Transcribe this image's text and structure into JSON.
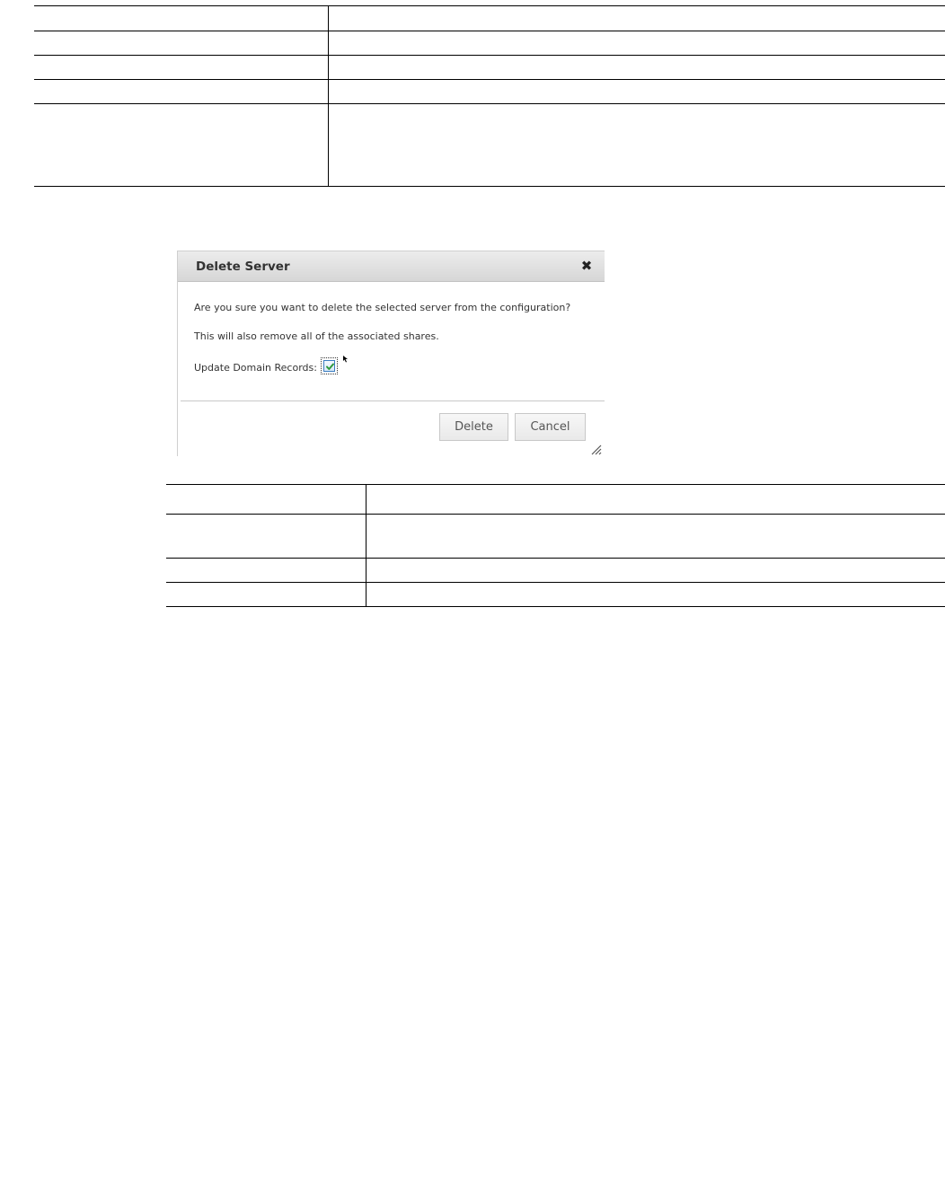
{
  "top_table": {
    "rows": [
      {
        "label": "",
        "value": ""
      },
      {
        "label": "",
        "value": ""
      },
      {
        "label": "",
        "value": ""
      },
      {
        "label": "",
        "value": ""
      },
      {
        "label": "",
        "value": ""
      }
    ]
  },
  "dialog": {
    "title": "Delete Server",
    "close_icon": "close-icon",
    "message_1": "Are you sure you want to delete the selected server from the configuration?",
    "message_2": "This will also remove all of the associated shares.",
    "update_label": "Update Domain Records:",
    "update_checked": true,
    "delete_label": "Delete",
    "cancel_label": "Cancel",
    "accent_color": "#3a7cc0",
    "check_color": "#2e9a3c"
  },
  "bottom_table": {
    "rows": [
      {
        "label": "",
        "value": ""
      },
      {
        "label": "",
        "value": ""
      },
      {
        "label": "",
        "value": ""
      },
      {
        "label": "",
        "value": ""
      }
    ]
  }
}
